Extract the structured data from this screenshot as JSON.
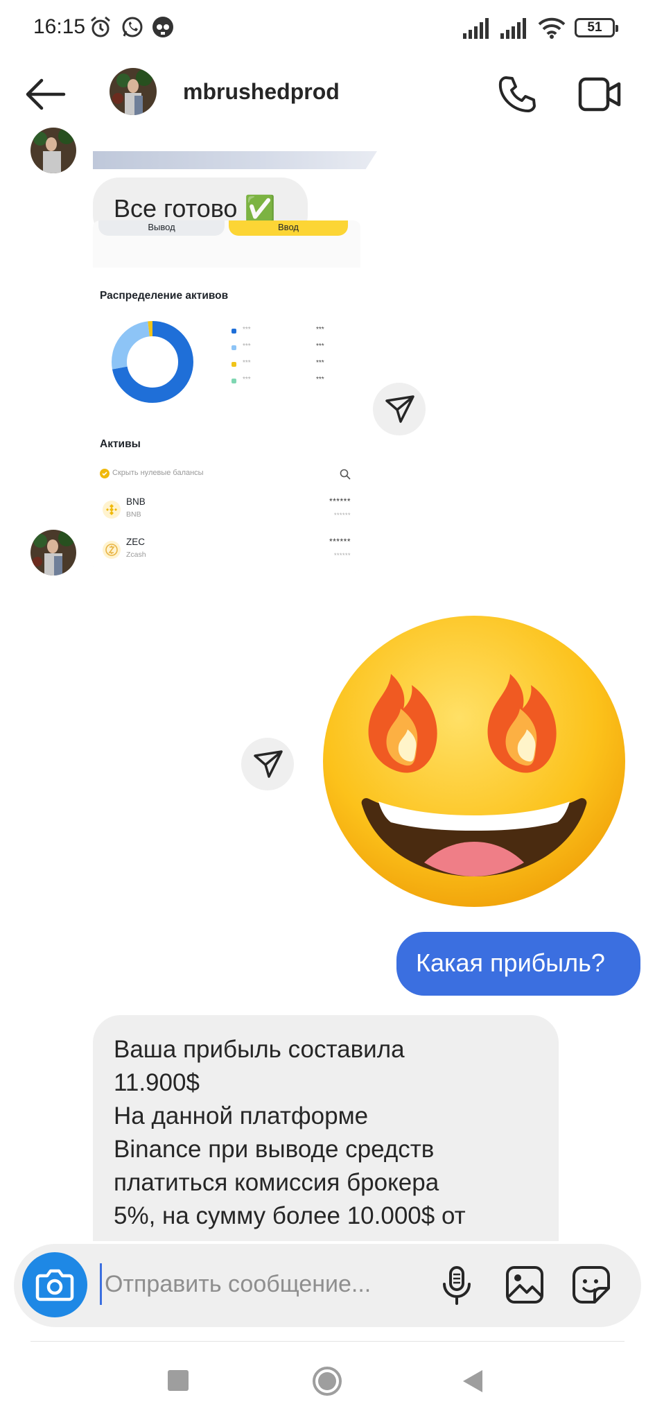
{
  "status_bar": {
    "time": "16:15",
    "battery": "51",
    "icons": [
      "alarm-icon",
      "whatsapp-icon",
      "skull-icon",
      "signal-icon",
      "signal-icon",
      "wifi-icon",
      "battery-icon"
    ]
  },
  "header": {
    "username": "mbrushedprod",
    "icons": [
      "back-arrow-icon",
      "phone-icon",
      "video-camera-icon"
    ]
  },
  "messages": {
    "ready_text": "Все готово ✅",
    "outgoing_question": "Какая прибыль?",
    "profit_lines": [
      "Ваша прибыль составила",
      "11.900$",
      "На данной платформе",
      "Binance  при выводе средств",
      "платиться комиссия брокера",
      "5%, на сумму более 10.000$ от"
    ]
  },
  "screenshot": {
    "btn_withdraw": "Вывод",
    "btn_deposit": "Ввод",
    "distribution_title": "Распределение активов",
    "legend": [
      {
        "color": "#1f6fd8",
        "label": "***",
        "value": "***"
      },
      {
        "color": "#8dc4f6",
        "label": "***",
        "value": "***"
      },
      {
        "color": "#f0c419",
        "label": "***",
        "value": "***"
      },
      {
        "color": "#7fd6b2",
        "label": "***",
        "value": "***"
      }
    ],
    "donut_shares": [
      0.72,
      0.26,
      0.02
    ],
    "assets_title": "Активы",
    "hide_zero_balances": "Скрыть нулевые балансы",
    "coins": [
      {
        "symbol": "BNB",
        "name": "BNB",
        "amount": "******",
        "value": "******"
      },
      {
        "symbol": "ZEC",
        "name": "Zcash",
        "amount": "******",
        "value": "******"
      }
    ]
  },
  "composer": {
    "placeholder": "Отправить сообщение..."
  },
  "colors": {
    "accent_blue": "#3b6fe0",
    "camera_blue": "#1e88e5",
    "bubble_gray": "#efefef"
  }
}
